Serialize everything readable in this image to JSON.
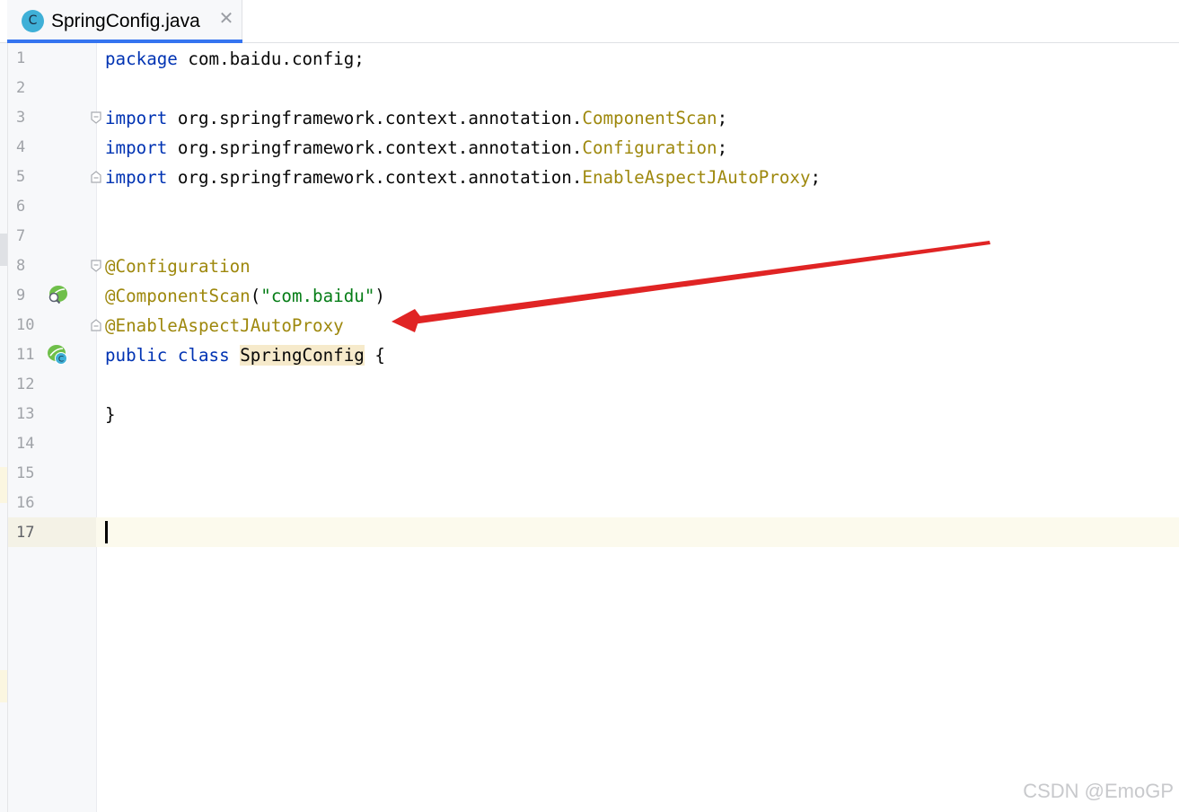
{
  "tab": {
    "icon_letter": "C",
    "title": "SpringConfig.java",
    "close_glyph": "✕"
  },
  "colors": {
    "keyword": "#0033b3",
    "annotation": "#9e880d",
    "string": "#067d17",
    "tab_underline": "#3574f0",
    "arrow": "#e02424"
  },
  "lines": [
    {
      "no": "1",
      "tokens": [
        {
          "t": "package",
          "c": "kw"
        },
        {
          "t": " com.baidu.config;",
          "c": "plain"
        }
      ]
    },
    {
      "no": "2",
      "tokens": []
    },
    {
      "no": "3",
      "tokens": [
        {
          "t": "import",
          "c": "kw"
        },
        {
          "t": " org.springframework.context.annotation.",
          "c": "plain"
        },
        {
          "t": "ComponentScan",
          "c": "ann"
        },
        {
          "t": ";",
          "c": "plain"
        }
      ]
    },
    {
      "no": "4",
      "tokens": [
        {
          "t": "import",
          "c": "kw"
        },
        {
          "t": " org.springframework.context.annotation.",
          "c": "plain"
        },
        {
          "t": "Configuration",
          "c": "ann"
        },
        {
          "t": ";",
          "c": "plain"
        }
      ]
    },
    {
      "no": "5",
      "tokens": [
        {
          "t": "import",
          "c": "kw"
        },
        {
          "t": " org.springframework.context.annotation.",
          "c": "plain"
        },
        {
          "t": "EnableAspectJAutoProxy",
          "c": "ann"
        },
        {
          "t": ";",
          "c": "plain"
        }
      ]
    },
    {
      "no": "6",
      "tokens": []
    },
    {
      "no": "7",
      "tokens": []
    },
    {
      "no": "8",
      "tokens": [
        {
          "t": "@Configuration",
          "c": "ann"
        }
      ]
    },
    {
      "no": "9",
      "tokens": [
        {
          "t": "@ComponentScan",
          "c": "ann"
        },
        {
          "t": "(",
          "c": "plain"
        },
        {
          "t": "\"com.baidu\"",
          "c": "str"
        },
        {
          "t": ")",
          "c": "plain"
        }
      ]
    },
    {
      "no": "10",
      "tokens": [
        {
          "t": "@EnableAspectJAutoProxy",
          "c": "ann"
        }
      ]
    },
    {
      "no": "11",
      "tokens": [
        {
          "t": "public",
          "c": "kw"
        },
        {
          "t": " ",
          "c": "plain"
        },
        {
          "t": "class",
          "c": "kw"
        },
        {
          "t": " ",
          "c": "plain"
        },
        {
          "t": "SpringConfig",
          "c": "plain hl"
        },
        {
          "t": " {",
          "c": "plain"
        }
      ]
    },
    {
      "no": "12",
      "tokens": []
    },
    {
      "no": "13",
      "tokens": [
        {
          "t": "}",
          "c": "plain"
        }
      ]
    },
    {
      "no": "14",
      "tokens": []
    },
    {
      "no": "15",
      "tokens": []
    },
    {
      "no": "16",
      "tokens": []
    },
    {
      "no": "17",
      "tokens": []
    }
  ],
  "gutter_icons": {
    "line9": "spring-bean-search-icon",
    "line11": "spring-bean-class-icon"
  },
  "watermark": "CSDN @EmoGP"
}
